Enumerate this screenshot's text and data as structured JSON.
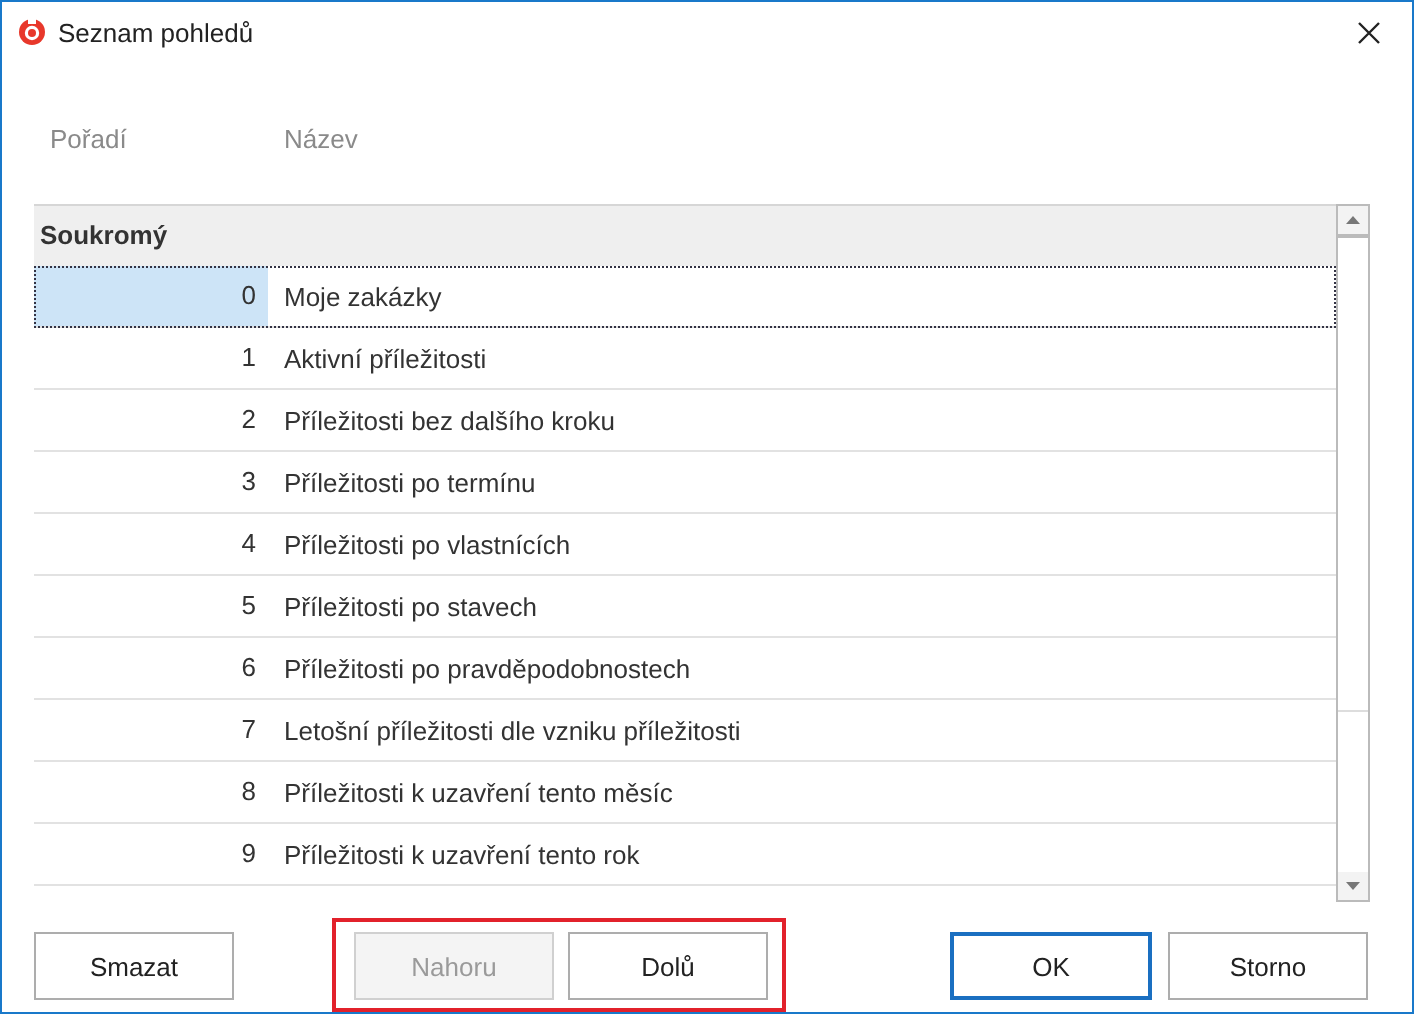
{
  "window": {
    "title": "Seznam pohledů"
  },
  "columns": [
    "Pořadí",
    "Název"
  ],
  "group": {
    "label": "Soukromý"
  },
  "rows": [
    {
      "order": "0",
      "name": "Moje zakázky",
      "selected": true
    },
    {
      "order": "1",
      "name": "Aktivní příležitosti",
      "selected": false
    },
    {
      "order": "2",
      "name": "Příležitosti bez dalšího kroku",
      "selected": false
    },
    {
      "order": "3",
      "name": "Příležitosti po termínu",
      "selected": false
    },
    {
      "order": "4",
      "name": "Příležitosti po vlastnících",
      "selected": false
    },
    {
      "order": "5",
      "name": "Příležitosti po stavech",
      "selected": false
    },
    {
      "order": "6",
      "name": "Příležitosti po pravděpodobnostech",
      "selected": false
    },
    {
      "order": "7",
      "name": "Letošní příležitosti dle vzniku příležitosti",
      "selected": false
    },
    {
      "order": "8",
      "name": "Příležitosti k uzavření tento měsíc",
      "selected": false
    },
    {
      "order": "9",
      "name": "Příležitosti k uzavření tento rok",
      "selected": false
    }
  ],
  "button_groups": [
    {
      "highlighted": false,
      "buttons": [
        {
          "label": "Smazat",
          "kind": "plain",
          "disabled": false
        }
      ]
    },
    {
      "highlighted": true,
      "buttons": [
        {
          "label": "Nahoru",
          "kind": "move",
          "disabled": true
        },
        {
          "label": "Dolů",
          "kind": "move",
          "disabled": false
        }
      ]
    },
    {
      "highlighted": false,
      "buttons": [
        {
          "label": "OK",
          "kind": "default",
          "disabled": false
        },
        {
          "label": "Storno",
          "kind": "plain",
          "disabled": false
        }
      ]
    }
  ]
}
